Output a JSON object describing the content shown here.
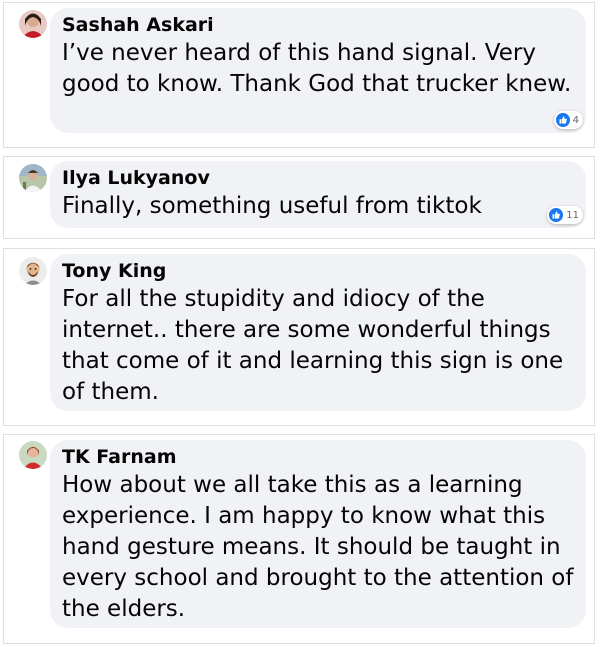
{
  "accent_color": "#1877f2",
  "comments": [
    {
      "author": "Sashah Askari",
      "text": "I’ve never heard of this hand signal. Very good to know. Thank God that trucker knew.",
      "reaction_icon": "like-icon",
      "reaction_count": "4"
    },
    {
      "author": "Ilya Lukyanov",
      "text": "Finally, something useful from tiktok",
      "reaction_icon": "like-icon",
      "reaction_count": "11"
    },
    {
      "author": "Tony King",
      "text": "For all the stupidity and idiocy of the internet.. there are some wonderful things that come of it and learning this sign is one of them."
    },
    {
      "author": "TK Farnam",
      "text": "How about we all take this as a learning experience. I am happy to know what this hand gesture means. It should be taught in every school and brought to the attention of the elders."
    }
  ]
}
